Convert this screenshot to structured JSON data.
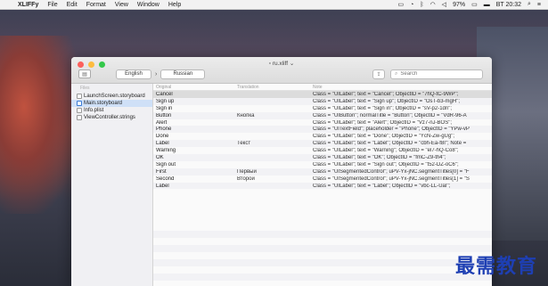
{
  "menubar": {
    "app_name": "XLIFFy",
    "items": [
      "File",
      "Edit",
      "Format",
      "View",
      "Window",
      "Help"
    ],
    "battery": "97%",
    "datetime": "BT 20:32"
  },
  "window": {
    "title": "ru.xliff",
    "source_lang": "English",
    "target_lang": "Russian",
    "search_placeholder": "Search"
  },
  "sidebar": {
    "header": "Files",
    "files": [
      {
        "name": "LaunchScreen.storyboard"
      },
      {
        "name": "Main.storyboard",
        "selected": true
      },
      {
        "name": "Info.plist"
      },
      {
        "name": "ViewController.strings"
      }
    ]
  },
  "table": {
    "headers": {
      "original": "Original",
      "translation": "Translation",
      "note": "Note"
    },
    "rows": [
      {
        "original": "Cancel",
        "translation": "",
        "note": "Class = \"UILabel\"; text = \"Cancel\"; ObjectID = \"7hQ-tC-9WP\";"
      },
      {
        "original": "Sign up",
        "translation": "",
        "note": "Class = \"UILabel\"; text = \"Sign up\"; ObjectID = \"OsT-b3-mgH\";"
      },
      {
        "original": "Sign in",
        "translation": "",
        "note": "Class = \"UILabel\"; text = \"Sign in\"; ObjectID = \"sV-p2-1dn\";"
      },
      {
        "original": "Button",
        "translation": "Кнопка",
        "note": "Class = \"UIButton\"; normalTitle = \"Button\"; ObjectID = \"VdR-96-A"
      },
      {
        "original": "Alert",
        "translation": "",
        "note": "Class = \"UILabel\"; text = \"Alert\"; ObjectID = \"Vz7-nJ-BOS\";"
      },
      {
        "original": "Phone",
        "translation": "",
        "note": "Class = \"UITextField\"; placeholder = \"Phone\"; ObjectID = \"YPw-vP"
      },
      {
        "original": "Done",
        "translation": "",
        "note": "Class = \"UILabel\"; text = \"Done\"; ObjectID = \"YcN-Zw-gUg\";"
      },
      {
        "original": "Label",
        "translation": "Текст",
        "note": "Class = \"UILabel\"; text = \"Label\"; ObjectID = \"cbh-Ea-f8I\"; Note ="
      },
      {
        "original": "Warning",
        "translation": "",
        "note": "Class = \"UILabel\"; text = \"Warning\"; ObjectID = \"el7-hQ-Co8\";"
      },
      {
        "original": "OK",
        "translation": "",
        "note": "Class = \"UILabel\"; text = \"OK\"; ObjectID = \"fmC-Z9-th4\";"
      },
      {
        "original": "Sign out",
        "translation": "",
        "note": "Class = \"UILabel\"; text = \"Sign out\"; ObjectID = \"t52-DZ-oC6\";"
      },
      {
        "original": "First",
        "translation": "Первый",
        "note": "Class = \"UISegmentedControl\"; uPV-Yx-jNC.segmentTitles[0] = \"F"
      },
      {
        "original": "Second",
        "translation": "Второй",
        "note": "Class = \"UISegmentedControl\"; uPV-Yx-jNC.segmentTitles[1] = \"S"
      },
      {
        "original": "Label",
        "translation": "",
        "note": "Class = \"UILabel\"; text = \"Label\"; ObjectID = \"vbc-LL-UaI\";"
      }
    ]
  },
  "watermark": "最需教育"
}
